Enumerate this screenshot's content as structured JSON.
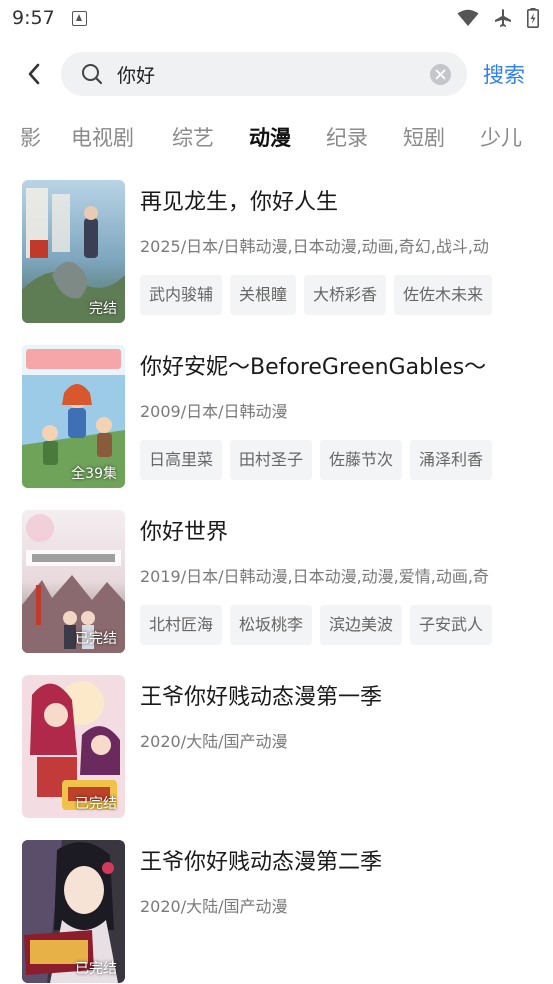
{
  "status_bar": {
    "time": "9:57"
  },
  "search": {
    "query": "你好",
    "button_label": "搜索"
  },
  "tabs": [
    {
      "label": "影"
    },
    {
      "label": "电视剧"
    },
    {
      "label": "综艺"
    },
    {
      "label": "动漫",
      "active": true
    },
    {
      "label": "纪录"
    },
    {
      "label": "短剧"
    },
    {
      "label": "少儿"
    }
  ],
  "results": [
    {
      "title": "再见龙生，你好人生",
      "meta": "2025/日本/日韩动漫,日本动漫,动画,奇幻,战斗,动",
      "badge": "完结",
      "cast": [
        "武内骏辅",
        "关根瞳",
        "大桥彩香",
        "佐佐木未来"
      ]
    },
    {
      "title": "你好安妮～BeforeGreenGables～",
      "meta": "2009/日本/日韩动漫",
      "badge": "全39集",
      "cast": [
        "日高里菜",
        "田村圣子",
        "佐藤节次",
        "涌泽利香"
      ]
    },
    {
      "title": "你好世界",
      "meta": "2019/日本/日韩动漫,日本动漫,动漫,爱情,动画,奇",
      "badge": "已完结",
      "cast": [
        "北村匠海",
        "松坂桃李",
        "滨边美波",
        "子安武人"
      ]
    },
    {
      "title": "王爷你好贱动态漫第一季",
      "meta": "2020/大陆/国产动漫",
      "badge": "已完结",
      "cast": []
    },
    {
      "title": "王爷你好贱动态漫第二季",
      "meta": "2020/大陆/国产动漫",
      "badge": "已完结",
      "cast": []
    }
  ],
  "colors": {
    "accent": "#2f7ff4",
    "search_bg": "#f0f1f3",
    "chip_bg": "#f3f4f6"
  }
}
